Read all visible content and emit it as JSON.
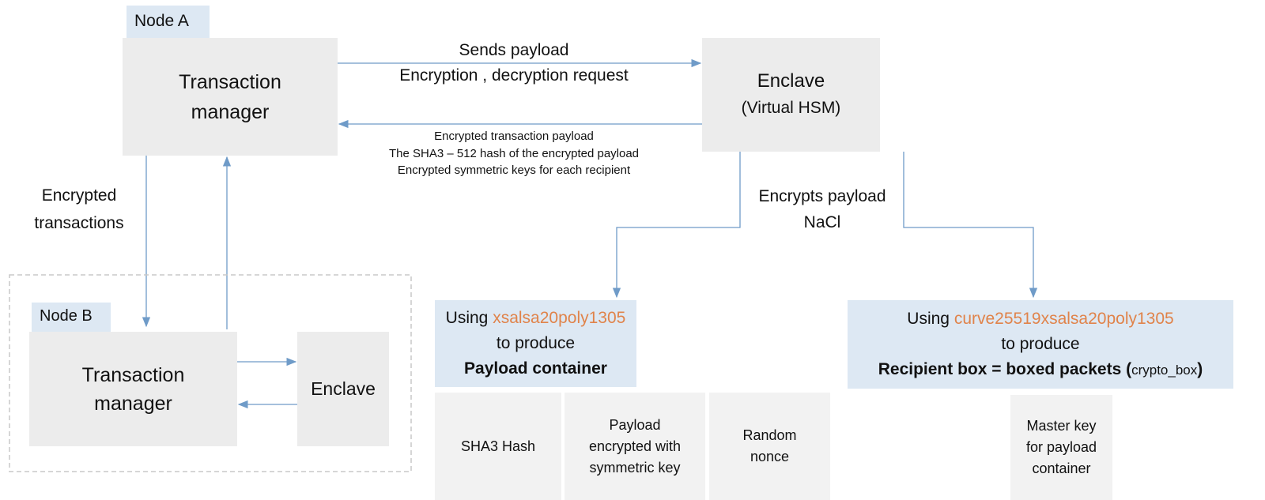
{
  "node_a": {
    "label": "Node A",
    "transaction_manager": [
      "Transaction",
      "manager"
    ]
  },
  "enclave_a": {
    "title": "Enclave",
    "subtitle": "(Virtual HSM)"
  },
  "request_arrow": {
    "line1": "Sends payload",
    "line2": "Encryption , decryption request"
  },
  "response_arrow": {
    "lines": [
      "Encrypted transaction payload",
      "The SHA3 – 512 hash of the encrypted payload",
      "Encrypted symmetric keys for each recipient"
    ]
  },
  "encrypted_transactions": [
    "Encrypted",
    "transactions"
  ],
  "node_b": {
    "label": "Node B",
    "transaction_manager": [
      "Transaction",
      "manager"
    ],
    "enclave": "Enclave"
  },
  "encrypts": {
    "line1": "Encrypts payload",
    "line2": "NaCl"
  },
  "payload_box": {
    "using": "Using ",
    "algorithm": "xsalsa20poly1305",
    "produce": "to produce",
    "result": "Payload container"
  },
  "recipient_box": {
    "using": "Using ",
    "algorithm": "curve25519xsalsa20poly1305",
    "produce": "to produce",
    "result": "Recipient box = boxed packets (",
    "result_code": "crypto_box",
    "result_end": ")"
  },
  "payload_parts": [
    "SHA3 Hash",
    "Payload encrypted with symmetric key",
    "Random nonce"
  ],
  "master_key": "Master key for payload container",
  "colors": {
    "arrow": "#6f9bc8",
    "box": "#ececec",
    "blue_box": "#dde8f3",
    "algorithm": "#e0834a"
  }
}
